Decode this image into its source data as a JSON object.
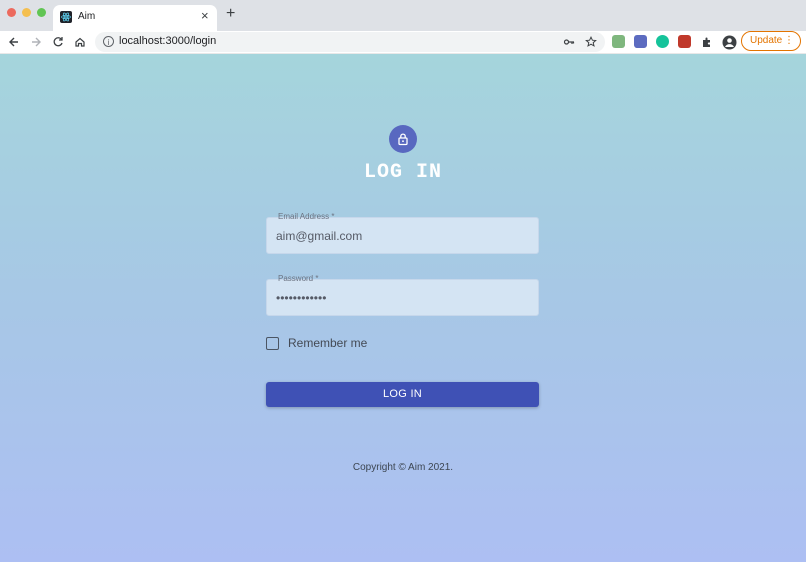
{
  "browser": {
    "tab_title": "Aim",
    "tab_close": "×",
    "new_tab": "+",
    "url": "localhost:3000/login",
    "update_label": "Update",
    "update_menu": "⋮",
    "icons": [
      "back-icon",
      "forward-icon",
      "reload-icon",
      "home-icon",
      "key-icon",
      "star-icon",
      "profile-icon",
      "extensions-icon"
    ]
  },
  "login": {
    "title": "LOG IN",
    "email_label": "Email Address *",
    "email_value": "aim@gmail.com",
    "password_label": "Password *",
    "password_value": "••••••••••••",
    "remember_label": "Remember me",
    "submit_label": "LOG IN",
    "copyright": "Copyright © Aim 2021."
  },
  "colors": {
    "accent": "#3f51b5",
    "avatar": "#5868c0",
    "update_orange": "#e37400"
  }
}
